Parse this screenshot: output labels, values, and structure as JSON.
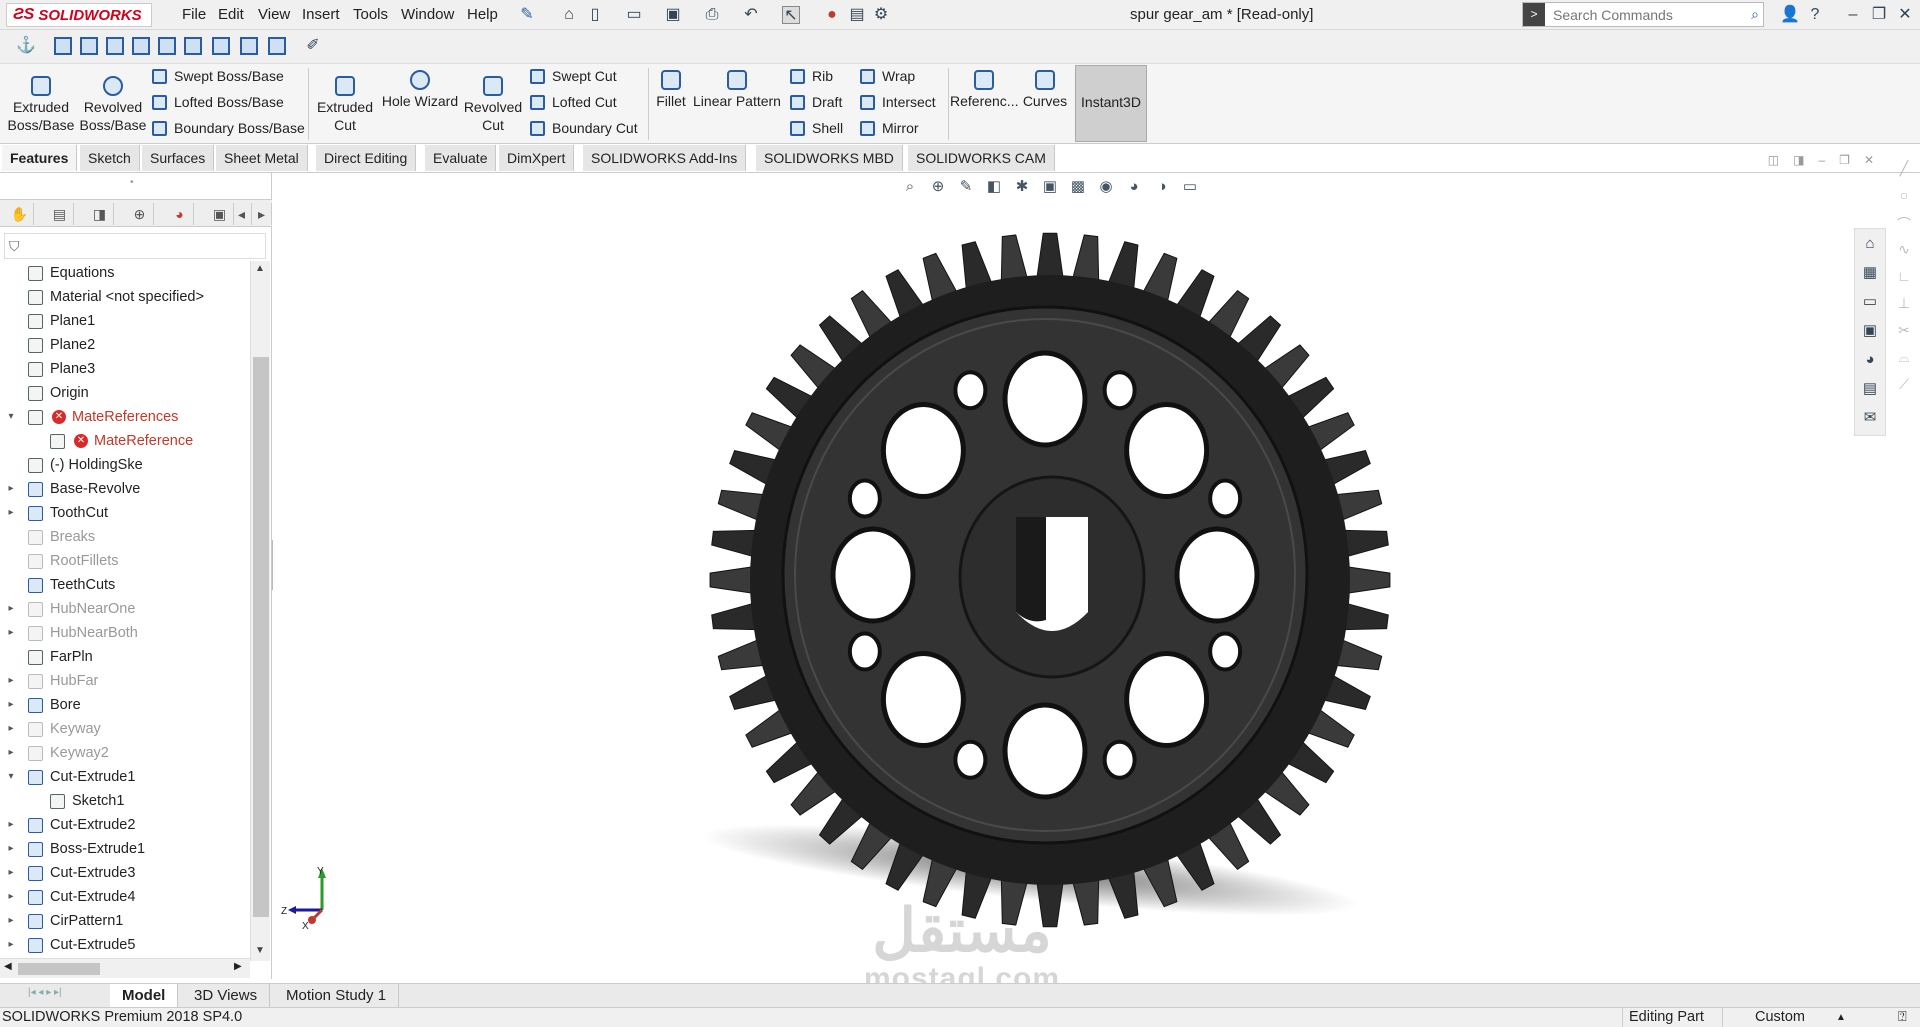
{
  "app": {
    "logo": "SOLIDWORKS",
    "doc_title": "spur gear_am * [Read-only]"
  },
  "menu": [
    "File",
    "Edit",
    "View",
    "Insert",
    "Tools",
    "Window",
    "Help"
  ],
  "search": {
    "placeholder": "Search Commands"
  },
  "ribbon": {
    "extruded_boss": "Extruded Boss/Base",
    "revolved_boss": "Revolved Boss/Base",
    "swept_boss": "Swept Boss/Base",
    "lofted_boss": "Lofted Boss/Base",
    "boundary_boss": "Boundary Boss/Base",
    "extruded_cut": "Extruded Cut",
    "hole_wizard": "Hole Wizard",
    "revolved_cut": "Revolved Cut",
    "swept_cut": "Swept Cut",
    "lofted_cut": "Lofted Cut",
    "boundary_cut": "Boundary Cut",
    "fillet": "Fillet",
    "linear_pattern": "Linear Pattern",
    "rib": "Rib",
    "draft": "Draft",
    "shell": "Shell",
    "wrap": "Wrap",
    "intersect": "Intersect",
    "mirror": "Mirror",
    "reference": "Referenc...",
    "curves": "Curves",
    "instant3d": "Instant3D"
  },
  "tabs": [
    "Features",
    "Sketch",
    "Surfaces",
    "Sheet Metal",
    "Direct Editing",
    "Evaluate",
    "DimXpert",
    "SOLIDWORKS Add-Ins",
    "SOLIDWORKS MBD",
    "SOLIDWORKS CAM"
  ],
  "tree": [
    {
      "label": "Equations",
      "state": "normal",
      "arrow": ""
    },
    {
      "label": "Material <not specified>",
      "state": "normal",
      "arrow": ""
    },
    {
      "label": "Plane1",
      "state": "normal",
      "arrow": ""
    },
    {
      "label": "Plane2",
      "state": "normal",
      "arrow": ""
    },
    {
      "label": "Plane3",
      "state": "normal",
      "arrow": ""
    },
    {
      "label": "Origin",
      "state": "normal",
      "arrow": ""
    },
    {
      "label": "MateReferences",
      "state": "err",
      "arrow": "open"
    },
    {
      "label": "MateReference",
      "state": "err",
      "arrow": "",
      "indent": 1
    },
    {
      "label": "(-) HoldingSke",
      "state": "normal",
      "arrow": ""
    },
    {
      "label": "Base-Revolve",
      "state": "blue",
      "arrow": "closed"
    },
    {
      "label": "ToothCut",
      "state": "blue",
      "arrow": "closed"
    },
    {
      "label": "Breaks",
      "state": "sup",
      "arrow": ""
    },
    {
      "label": "RootFillets",
      "state": "sup",
      "arrow": ""
    },
    {
      "label": "TeethCuts",
      "state": "blue",
      "arrow": ""
    },
    {
      "label": "HubNearOne",
      "state": "sup",
      "arrow": "closed"
    },
    {
      "label": "HubNearBoth",
      "state": "sup",
      "arrow": "closed"
    },
    {
      "label": "FarPln",
      "state": "normal",
      "arrow": ""
    },
    {
      "label": "HubFar",
      "state": "sup",
      "arrow": "closed"
    },
    {
      "label": "Bore",
      "state": "blue",
      "arrow": "closed"
    },
    {
      "label": "Keyway",
      "state": "sup",
      "arrow": "closed"
    },
    {
      "label": "Keyway2",
      "state": "sup",
      "arrow": "closed"
    },
    {
      "label": "Cut-Extrude1",
      "state": "blue",
      "arrow": "open"
    },
    {
      "label": "Sketch1",
      "state": "normal",
      "arrow": "",
      "indent": 1
    },
    {
      "label": "Cut-Extrude2",
      "state": "blue",
      "arrow": "closed"
    },
    {
      "label": "Boss-Extrude1",
      "state": "blue",
      "arrow": "closed"
    },
    {
      "label": "Cut-Extrude3",
      "state": "blue",
      "arrow": "closed"
    },
    {
      "label": "Cut-Extrude4",
      "state": "blue",
      "arrow": "closed"
    },
    {
      "label": "CirPattern1",
      "state": "blue",
      "arrow": "closed"
    },
    {
      "label": "Cut-Extrude5",
      "state": "blue",
      "arrow": "closed"
    }
  ],
  "bottom_tabs": [
    "Model",
    "3D Views",
    "Motion Study 1"
  ],
  "status": {
    "left": "SOLIDWORKS Premium 2018 SP4.0",
    "mode": "Editing Part",
    "units": "Custom"
  },
  "triad": {
    "y": "Y",
    "z": "Z",
    "x": "X"
  },
  "watermark": {
    "arabic": "مستقل",
    "latin": "mostaql.com"
  }
}
